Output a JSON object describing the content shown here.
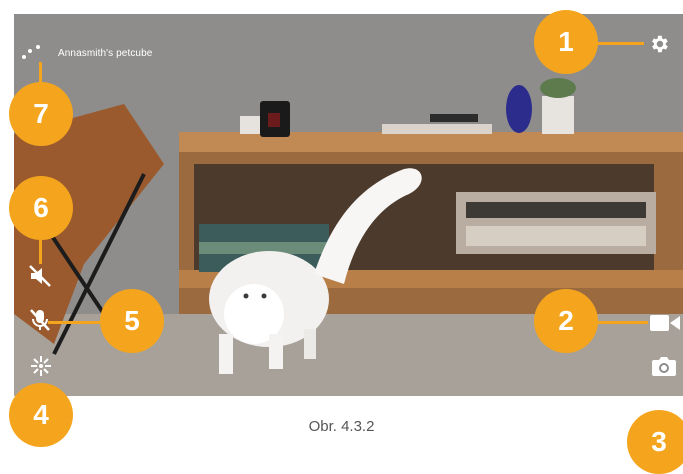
{
  "camera": {
    "name": "Annasmith's petcube"
  },
  "callouts": {
    "settings": "1",
    "record_video": "2",
    "snapshot": "3",
    "laser": "4",
    "mic": "5",
    "speaker": "6",
    "connection": "7"
  },
  "caption": "Obr. 4.3.2",
  "icons": {
    "settings": "gear-icon",
    "record_video": "video-camera-icon",
    "snapshot": "photo-camera-icon",
    "laser": "laser-icon",
    "mic": "microphone-muted-icon",
    "speaker": "speaker-muted-icon",
    "connection": "connection-dots-icon"
  },
  "colors": {
    "accent": "#f4a51d",
    "icon": "#ffffff"
  }
}
